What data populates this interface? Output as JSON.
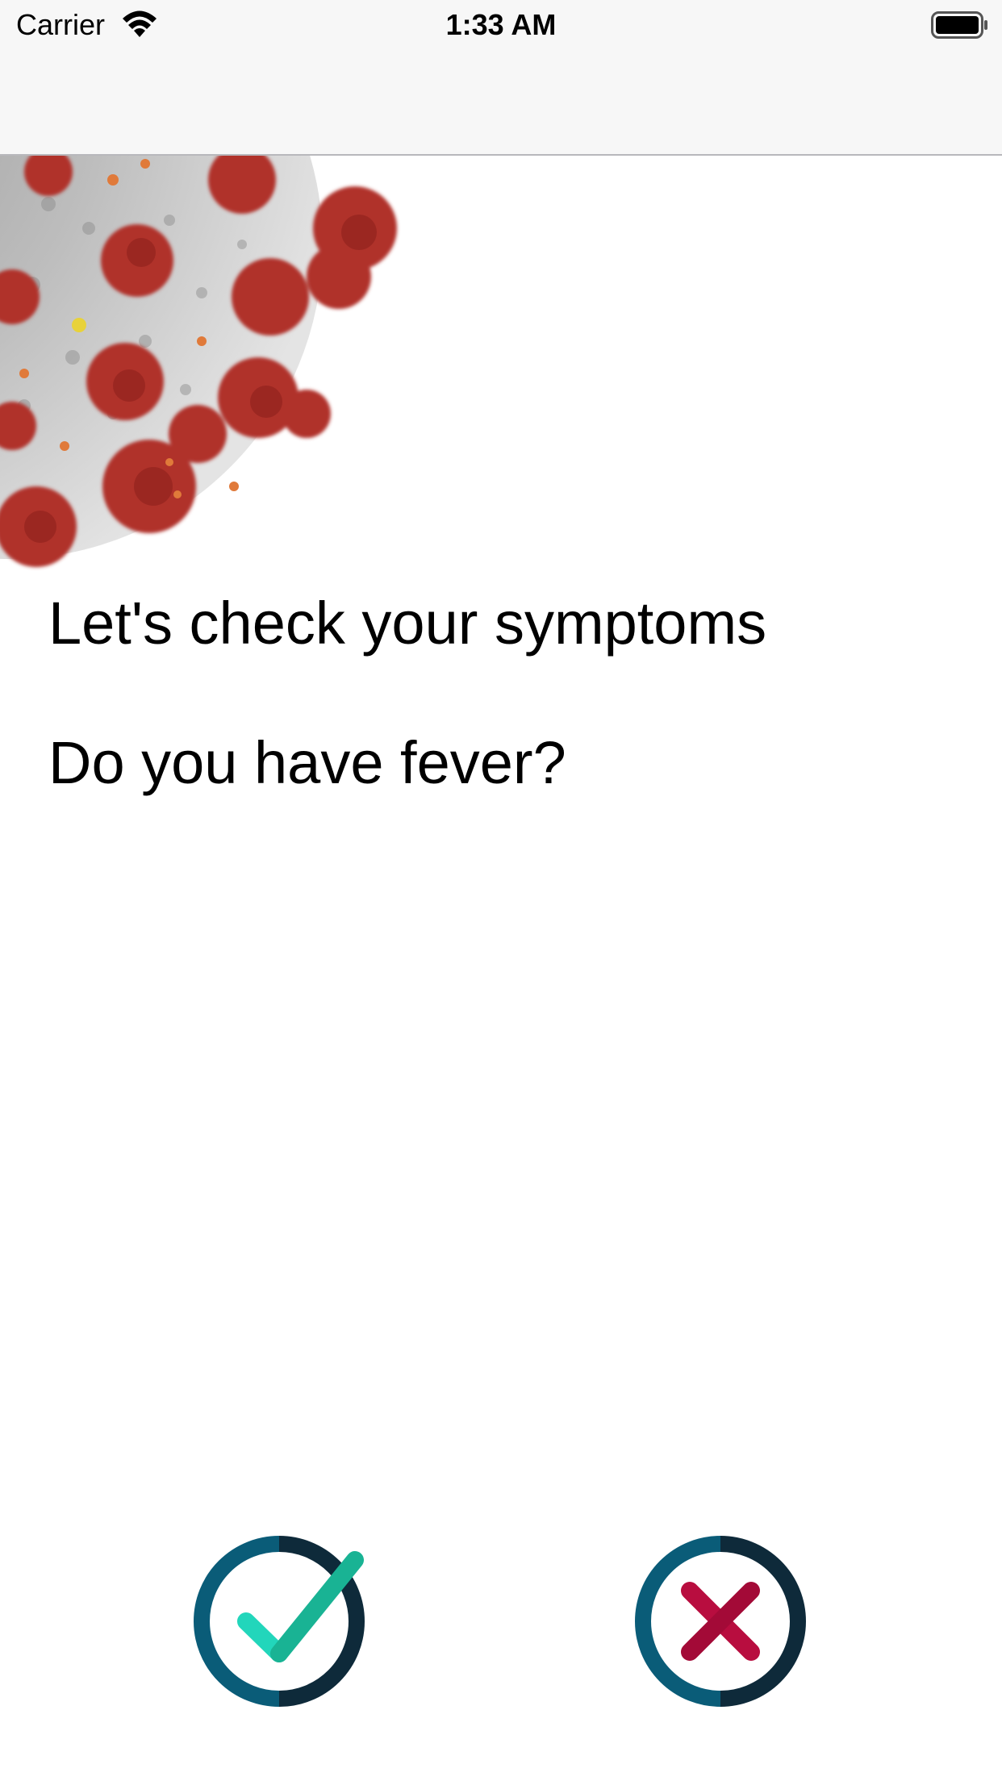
{
  "status_bar": {
    "carrier": "Carrier",
    "time": "1:33 AM",
    "icons": [
      "wifi-icon",
      "battery-icon"
    ]
  },
  "main": {
    "image": "coronavirus-image",
    "heading": "Let's check your symptoms",
    "question": "Do you have fever?"
  },
  "answers": {
    "yes_icon": "check-icon",
    "no_icon": "close-icon"
  },
  "colors": {
    "ring_dark": "#0e2a3a",
    "ring_blue": "#0a5c78",
    "check_green": "#19b394",
    "cross_red": "#b80d3f"
  }
}
